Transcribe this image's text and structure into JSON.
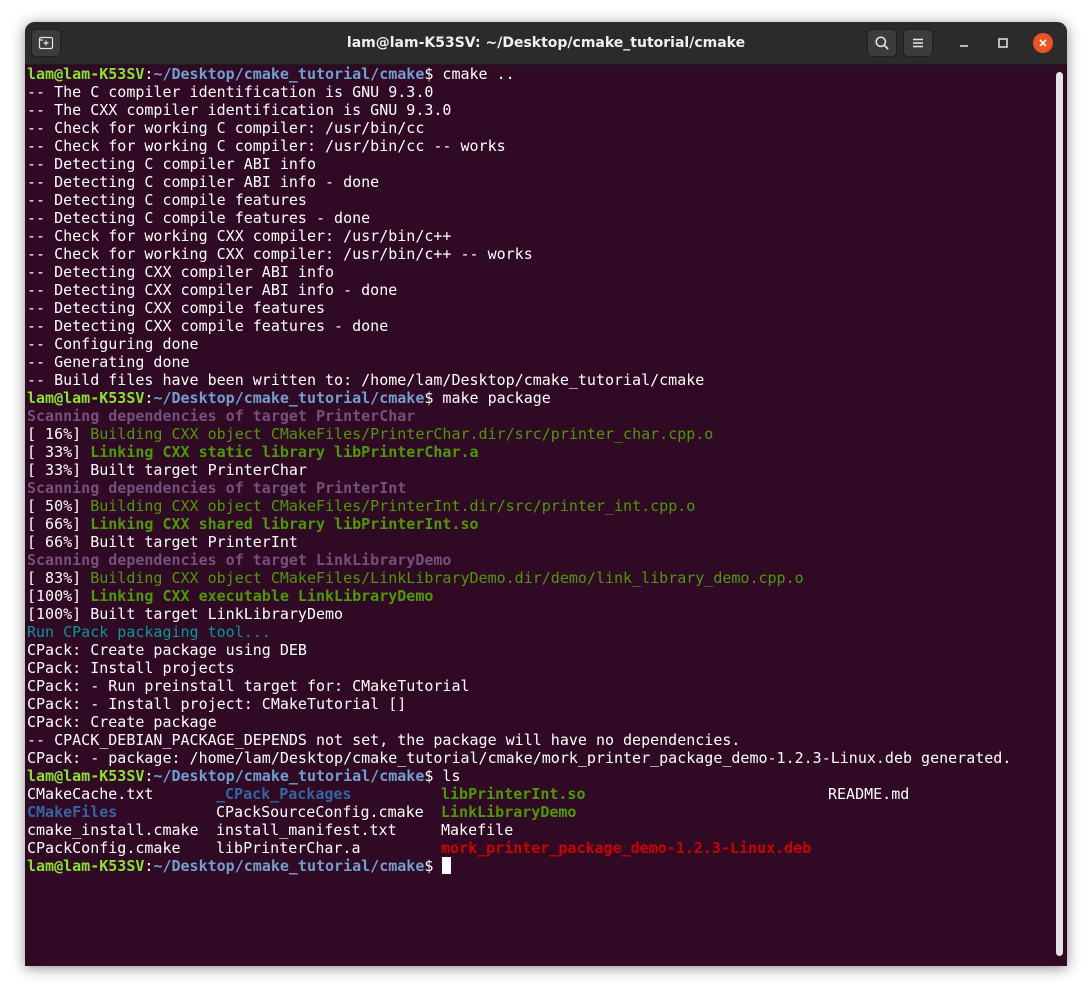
{
  "window": {
    "title": "lam@lam-K53SV: ~/Desktop/cmake_tutorial/cmake",
    "icons": [
      "new-tab-icon",
      "search-icon",
      "menu-icon",
      "minimize-icon",
      "maximize-icon",
      "close-icon"
    ]
  },
  "colors": {
    "background": "#300a24",
    "user": "#8ae234",
    "path": "#729fcf",
    "scanning": "#75507b",
    "building": "#4e9a06",
    "cpack_run": "#06989a",
    "directory": "#3465a4",
    "deb_file": "#cc0000"
  },
  "prompt": {
    "user": "lam@lam-K53SV",
    "sep": ":",
    "path": "~/Desktop/cmake_tutorial/cmake",
    "dollar": "$"
  },
  "commands": {
    "cmake": " cmake ..",
    "make": " make package",
    "ls": " ls"
  },
  "cmake_output": [
    "-- The C compiler identification is GNU 9.3.0",
    "-- The CXX compiler identification is GNU 9.3.0",
    "-- Check for working C compiler: /usr/bin/cc",
    "-- Check for working C compiler: /usr/bin/cc -- works",
    "-- Detecting C compiler ABI info",
    "-- Detecting C compiler ABI info - done",
    "-- Detecting C compile features",
    "-- Detecting C compile features - done",
    "-- Check for working CXX compiler: /usr/bin/c++",
    "-- Check for working CXX compiler: /usr/bin/c++ -- works",
    "-- Detecting CXX compiler ABI info",
    "-- Detecting CXX compiler ABI info - done",
    "-- Detecting CXX compile features",
    "-- Detecting CXX compile features - done",
    "-- Configuring done",
    "-- Generating done",
    "-- Build files have been written to: /home/lam/Desktop/cmake_tutorial/cmake"
  ],
  "make_output": [
    {
      "pct": "",
      "text": "Scanning dependencies of target PrinterChar",
      "style": "scan"
    },
    {
      "pct": "[ 16%] ",
      "text": "Building CXX object CMakeFiles/PrinterChar.dir/src/printer_char.cpp.o",
      "style": "bld"
    },
    {
      "pct": "[ 33%] ",
      "text": "Linking CXX static library libPrinterChar.a",
      "style": "lnk"
    },
    {
      "pct": "[ 33%] ",
      "text": "Built target PrinterChar",
      "style": "plain"
    },
    {
      "pct": "",
      "text": "Scanning dependencies of target PrinterInt",
      "style": "scan"
    },
    {
      "pct": "[ 50%] ",
      "text": "Building CXX object CMakeFiles/PrinterInt.dir/src/printer_int.cpp.o",
      "style": "bld"
    },
    {
      "pct": "[ 66%] ",
      "text": "Linking CXX shared library libPrinterInt.so",
      "style": "lnk"
    },
    {
      "pct": "[ 66%] ",
      "text": "Built target PrinterInt",
      "style": "plain"
    },
    {
      "pct": "",
      "text": "Scanning dependencies of target LinkLibraryDemo",
      "style": "scan"
    },
    {
      "pct": "[ 83%] ",
      "text": "Building CXX object CMakeFiles/LinkLibraryDemo.dir/demo/link_library_demo.cpp.o",
      "style": "bld"
    },
    {
      "pct": "[100%] ",
      "text": "Linking CXX executable LinkLibraryDemo",
      "style": "lnk"
    },
    {
      "pct": "[100%] ",
      "text": "Built target LinkLibraryDemo",
      "style": "plain"
    },
    {
      "pct": "",
      "text": "Run CPack packaging tool...",
      "style": "cyan"
    },
    {
      "pct": "",
      "text": "CPack: Create package using DEB",
      "style": "plain"
    },
    {
      "pct": "",
      "text": "CPack: Install projects",
      "style": "plain"
    },
    {
      "pct": "",
      "text": "CPack: - Run preinstall target for: CMakeTutorial",
      "style": "plain"
    },
    {
      "pct": "",
      "text": "CPack: - Install project: CMakeTutorial []",
      "style": "plain"
    },
    {
      "pct": "",
      "text": "CPack: Create package",
      "style": "plain"
    },
    {
      "pct": "",
      "text": "-- CPACK_DEBIAN_PACKAGE_DEPENDS not set, the package will have no dependencies.",
      "style": "plain"
    },
    {
      "pct": "",
      "text": "CPack: - package: /home/lam/Desktop/cmake_tutorial/cmake/mork_printer_package_demo-1.2.3-Linux.deb generated.",
      "style": "plain"
    }
  ],
  "ls_output": [
    [
      {
        "name": "CMakeCache.txt",
        "style": "plain"
      },
      {
        "name": "_CPack_Packages",
        "style": "dir"
      },
      {
        "name": "libPrinterInt.so",
        "style": "lnk"
      },
      {
        "name": "README.md",
        "style": "plain"
      }
    ],
    [
      {
        "name": "CMakeFiles",
        "style": "dir"
      },
      {
        "name": "CPackSourceConfig.cmake",
        "style": "plain"
      },
      {
        "name": "LinkLibraryDemo",
        "style": "lnk"
      },
      {
        "name": "",
        "style": "plain"
      }
    ],
    [
      {
        "name": "cmake_install.cmake",
        "style": "plain"
      },
      {
        "name": "install_manifest.txt",
        "style": "plain"
      },
      {
        "name": "Makefile",
        "style": "plain"
      },
      {
        "name": "",
        "style": "plain"
      }
    ],
    [
      {
        "name": "CPackConfig.cmake",
        "style": "plain"
      },
      {
        "name": "libPrinterChar.a",
        "style": "plain"
      },
      {
        "name": "mork_printer_package_demo-1.2.3-Linux.deb",
        "style": "deb"
      },
      {
        "name": "",
        "style": "plain"
      }
    ]
  ]
}
